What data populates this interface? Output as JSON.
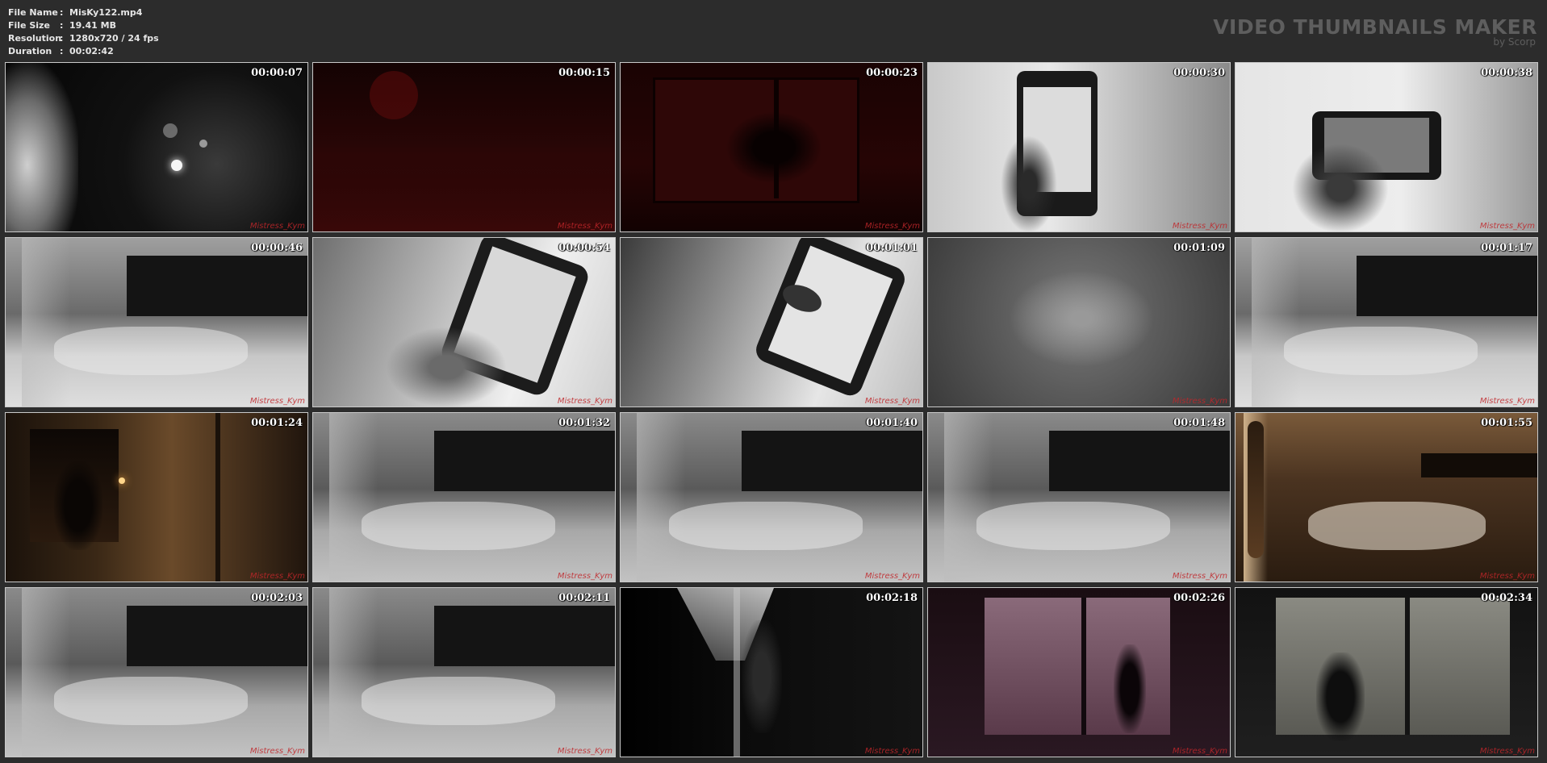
{
  "meta": {
    "rows": [
      {
        "label": "File Name",
        "value": "MisKy122.mp4"
      },
      {
        "label": "File Size",
        "value": "19.41 MB"
      },
      {
        "label": "Resolution",
        "value": "1280x720 / 24 fps"
      },
      {
        "label": "Duration",
        "value": "00:02:42"
      }
    ],
    "separator": ":"
  },
  "brand": {
    "title": "VIDEO THUMBNAILS MAKER",
    "subtitle": "by Scorp"
  },
  "watermark": "Mistress_Kym",
  "thumbnails": [
    {
      "time": "00:00:07",
      "scene": "s-dark-face"
    },
    {
      "time": "00:00:15",
      "scene": "s-red-night"
    },
    {
      "time": "00:00:23",
      "scene": "s-red-dark"
    },
    {
      "time": "00:00:30",
      "scene": "s-phone-bw"
    },
    {
      "time": "00:00:38",
      "scene": "s-phone-bw2"
    },
    {
      "time": "00:00:46",
      "scene": "s-bed"
    },
    {
      "time": "00:00:54",
      "scene": "s-phone-hand"
    },
    {
      "time": "00:01:01",
      "scene": "s-phone-hand2"
    },
    {
      "time": "00:01:09",
      "scene": "s-blur"
    },
    {
      "time": "00:01:17",
      "scene": "s-bed"
    },
    {
      "time": "00:01:24",
      "scene": "s-room-warm"
    },
    {
      "time": "00:01:32",
      "scene": "s-bed-dark"
    },
    {
      "time": "00:01:40",
      "scene": "s-bed-dark"
    },
    {
      "time": "00:01:48",
      "scene": "s-bed-dark"
    },
    {
      "time": "00:01:55",
      "scene": "s-warm-bed"
    },
    {
      "time": "00:02:03",
      "scene": "s-bed-dark"
    },
    {
      "time": "00:02:11",
      "scene": "s-bed-dark"
    },
    {
      "time": "00:02:18",
      "scene": "s-window-dark"
    },
    {
      "time": "00:02:26",
      "scene": "s-pink-window"
    },
    {
      "time": "00:02:34",
      "scene": "s-fog-window"
    }
  ]
}
